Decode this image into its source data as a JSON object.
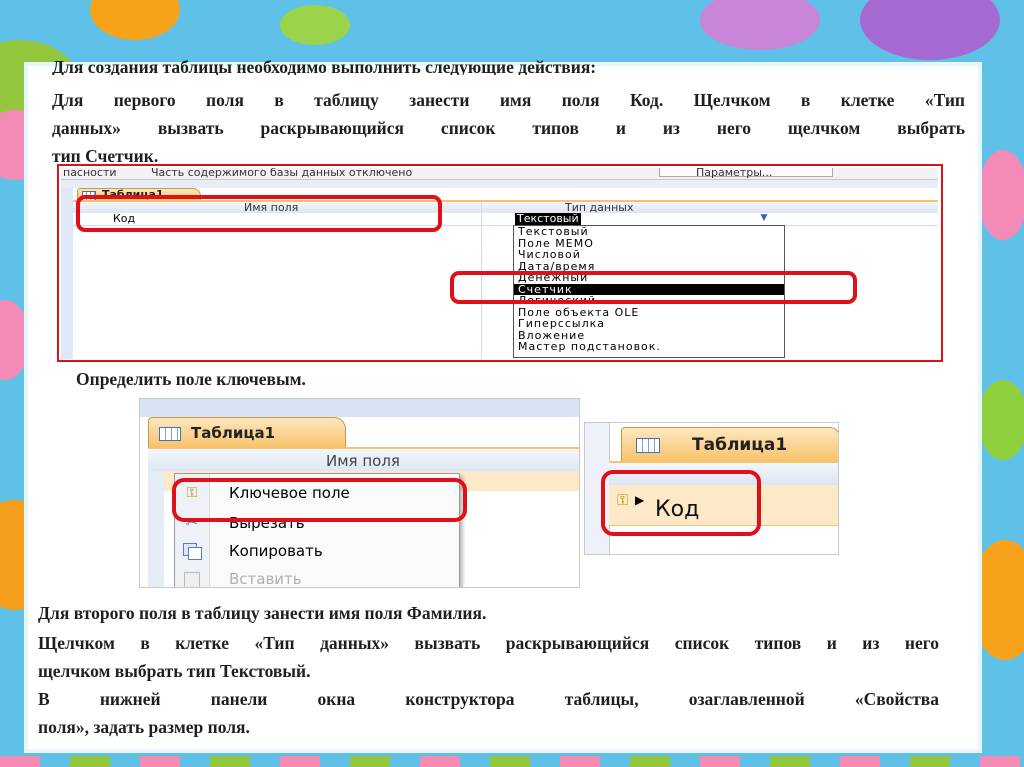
{
  "colors": {
    "background": "#5fc1e8",
    "highlight_frame": "#e0101a",
    "tab_orange": "#f9c87a",
    "selection": "#000000"
  },
  "header": {
    "title": "Для создания таблицы необходимо выполнить следующие действия:",
    "line1": "Для первого поля в таблицу занести имя поля Код. Щелчком в клетке «Тип",
    "line2": "данных» вызвать раскрывающийся список типов и из него щелчком выбрать",
    "line3": "тип Счетчик."
  },
  "shot1": {
    "security_bar": {
      "left": "пасности",
      "center": "Часть содержимого базы данных отключено",
      "button": "Параметры..."
    },
    "tab": "Таблица1",
    "col_field_name": "Имя поля",
    "col_data_type": "Тип данных",
    "row_field": "Код",
    "row_type": "Текстовый",
    "dropdown_icon": "chevron-down-icon",
    "options": [
      "Текстовый",
      "Поле МЕМО",
      "Числовой",
      "Дата/время",
      "Денежный",
      "Счетчик",
      "Логический",
      "Поле объекта OLE",
      "Гиперссылка",
      "Вложение",
      "Мастер подстановок."
    ],
    "selected_option": "Счетчик"
  },
  "instruction_key": "Определить поле ключевым.",
  "shot2": {
    "tab": "Таблица1",
    "col_field_name": "Имя поля",
    "menu": [
      {
        "label": "Ключевое поле",
        "icon": "key-icon"
      },
      {
        "label": "Вырезать",
        "icon": "scissors-icon"
      },
      {
        "label": "Копировать",
        "icon": "copy-icon"
      },
      {
        "label": "Вставить",
        "icon": "paste-icon"
      }
    ]
  },
  "shot3": {
    "tab": "Таблица1",
    "field": "Код",
    "icon": "key-icon"
  },
  "footer": {
    "line1": "Для второго поля в таблицу занести имя поля Фамилия.",
    "line2": "Щелчком в клетке «Тип данных» вызвать раскрывающийся список типов и из него",
    "line3": "щелчком выбрать тип Текстовый.",
    "line4": "В нижней панели окна конструктора таблицы, озаглавленной «Свойства",
    "line5": "поля», задать размер поля."
  }
}
